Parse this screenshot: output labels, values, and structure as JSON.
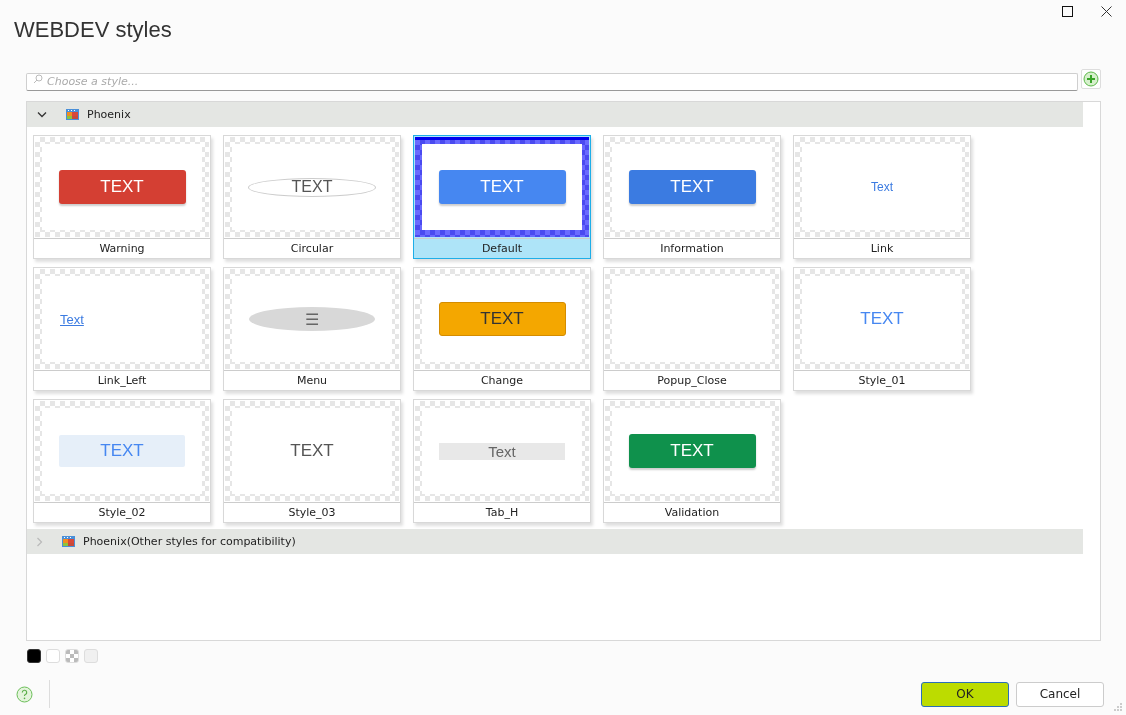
{
  "window": {
    "title": "WEBDEV styles"
  },
  "search": {
    "placeholder": "Choose a style..."
  },
  "groups": [
    {
      "name": "Phoenix",
      "expanded": true,
      "styles": [
        {
          "label": "Warning",
          "selected": false,
          "kind": "filled",
          "text": "TEXT",
          "color": "#d43f33"
        },
        {
          "label": "Circular",
          "selected": false,
          "kind": "ellipse",
          "text": "TEXT"
        },
        {
          "label": "Default",
          "selected": true,
          "kind": "filled",
          "text": "TEXT",
          "color": "#4687f1"
        },
        {
          "label": "Information",
          "selected": false,
          "kind": "filled",
          "text": "TEXT",
          "color": "#3b7be1"
        },
        {
          "label": "Link",
          "selected": false,
          "kind": "link",
          "text": "Text"
        },
        {
          "label": "Link_Left",
          "selected": false,
          "kind": "link-left",
          "text": "Text"
        },
        {
          "label": "Menu",
          "selected": false,
          "kind": "menu",
          "text": "☰"
        },
        {
          "label": "Change",
          "selected": false,
          "kind": "filled-dark",
          "text": "TEXT",
          "color": "#f4a700"
        },
        {
          "label": "Popup_Close",
          "selected": false,
          "kind": "empty"
        },
        {
          "label": "Style_01",
          "selected": false,
          "kind": "plain-blue",
          "text": "TEXT"
        },
        {
          "label": "Style_02",
          "selected": false,
          "kind": "pill",
          "text": "TEXT"
        },
        {
          "label": "Style_03",
          "selected": false,
          "kind": "plain",
          "text": "TEXT"
        },
        {
          "label": "Tab_H",
          "selected": false,
          "kind": "bar",
          "text": "Text"
        },
        {
          "label": "Validation",
          "selected": false,
          "kind": "filled",
          "text": "TEXT",
          "color": "#0f914c"
        }
      ]
    },
    {
      "name": "Phoenix(Other styles for compatibility)",
      "expanded": false
    }
  ],
  "buttons": [
    {
      "label": "OK",
      "kind": "primary"
    },
    {
      "label": "Cancel",
      "kind": "secondary"
    }
  ]
}
